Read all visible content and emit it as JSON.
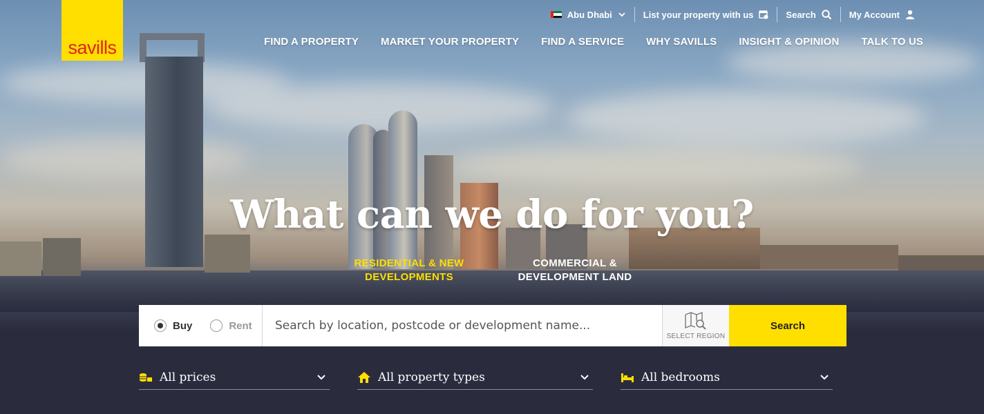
{
  "brand": {
    "logo_text": "savills",
    "logo_bg": "#ffdf00",
    "logo_fg": "#e2231a"
  },
  "topbar": {
    "location_label": "Abu Dhabi",
    "list_property_label": "List your property with us",
    "search_label": "Search",
    "account_label": "My Account"
  },
  "nav": {
    "items": [
      "FIND A PROPERTY",
      "MARKET YOUR PROPERTY",
      "FIND A SERVICE",
      "WHY SAVILLS",
      "INSIGHT & OPINION",
      "TALK TO US"
    ]
  },
  "hero": {
    "headline": "What can we do for you?"
  },
  "tabs": {
    "residential_line1": "RESIDENTIAL & NEW",
    "residential_line2": "DEVELOPMENTS",
    "commercial_line1": "COMMERCIAL &",
    "commercial_line2": "DEVELOPMENT LAND",
    "active_color": "#ffdf00"
  },
  "search": {
    "buy_label": "Buy",
    "rent_label": "Rent",
    "selected": "Buy",
    "placeholder": "Search by location, postcode or development name...",
    "region_label": "SELECT REGION",
    "button_label": "Search"
  },
  "filters": {
    "price_label": "All prices",
    "type_label": "All property types",
    "bedrooms_label": "All bedrooms"
  },
  "icons": [
    "uae-flag-icon",
    "chevron-down-icon",
    "calendar-house-icon",
    "search-icon",
    "user-icon",
    "map-search-icon",
    "coins-icon",
    "house-icon",
    "bed-icon"
  ],
  "colors": {
    "accent": "#ffdf00",
    "footer_bg": "#2a2c3e"
  }
}
